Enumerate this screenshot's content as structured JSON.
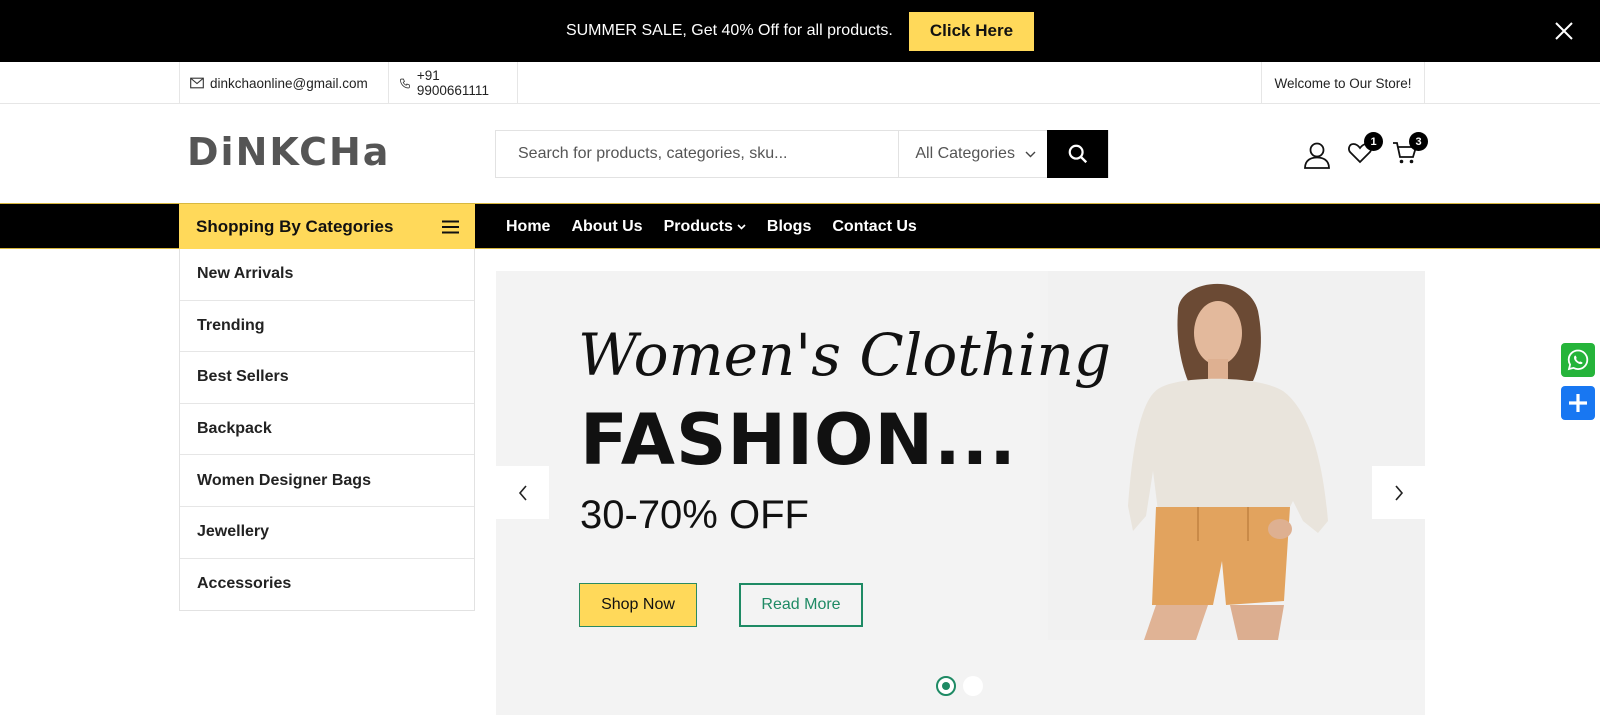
{
  "promo": {
    "text": "SUMMER SALE, Get 40% Off for all products.",
    "button": "Click Here"
  },
  "topbar": {
    "email": "dinkchaonline@gmail.com",
    "phone": "+91 9900661111",
    "welcome": "Welcome to Our Store!"
  },
  "header": {
    "logo": "DiNKCHa",
    "search_placeholder": "Search for products, categories, sku...",
    "category_select": "All Categories",
    "wishlist_count": "1",
    "cart_count": "3"
  },
  "nav": {
    "categories_title": "Shopping By Categories",
    "links": [
      "Home",
      "About Us",
      "Products",
      "Blogs",
      "Contact Us"
    ]
  },
  "categories": [
    "New Arrivals",
    "Trending",
    "Best Sellers",
    "Backpack",
    "Women Designer Bags",
    "Jewellery",
    "Accessories"
  ],
  "hero": {
    "script": "Women's Clothing",
    "title": "FASHION...",
    "subtitle": "30-70% OFF",
    "shop_button": "Shop Now",
    "read_button": "Read More",
    "active_slide": 1,
    "slide_count": 2
  },
  "colors": {
    "accent_yellow": "#ffd95a",
    "accent_green": "#1e8a64",
    "whatsapp": "#25b43a",
    "share": "#1877f2"
  }
}
